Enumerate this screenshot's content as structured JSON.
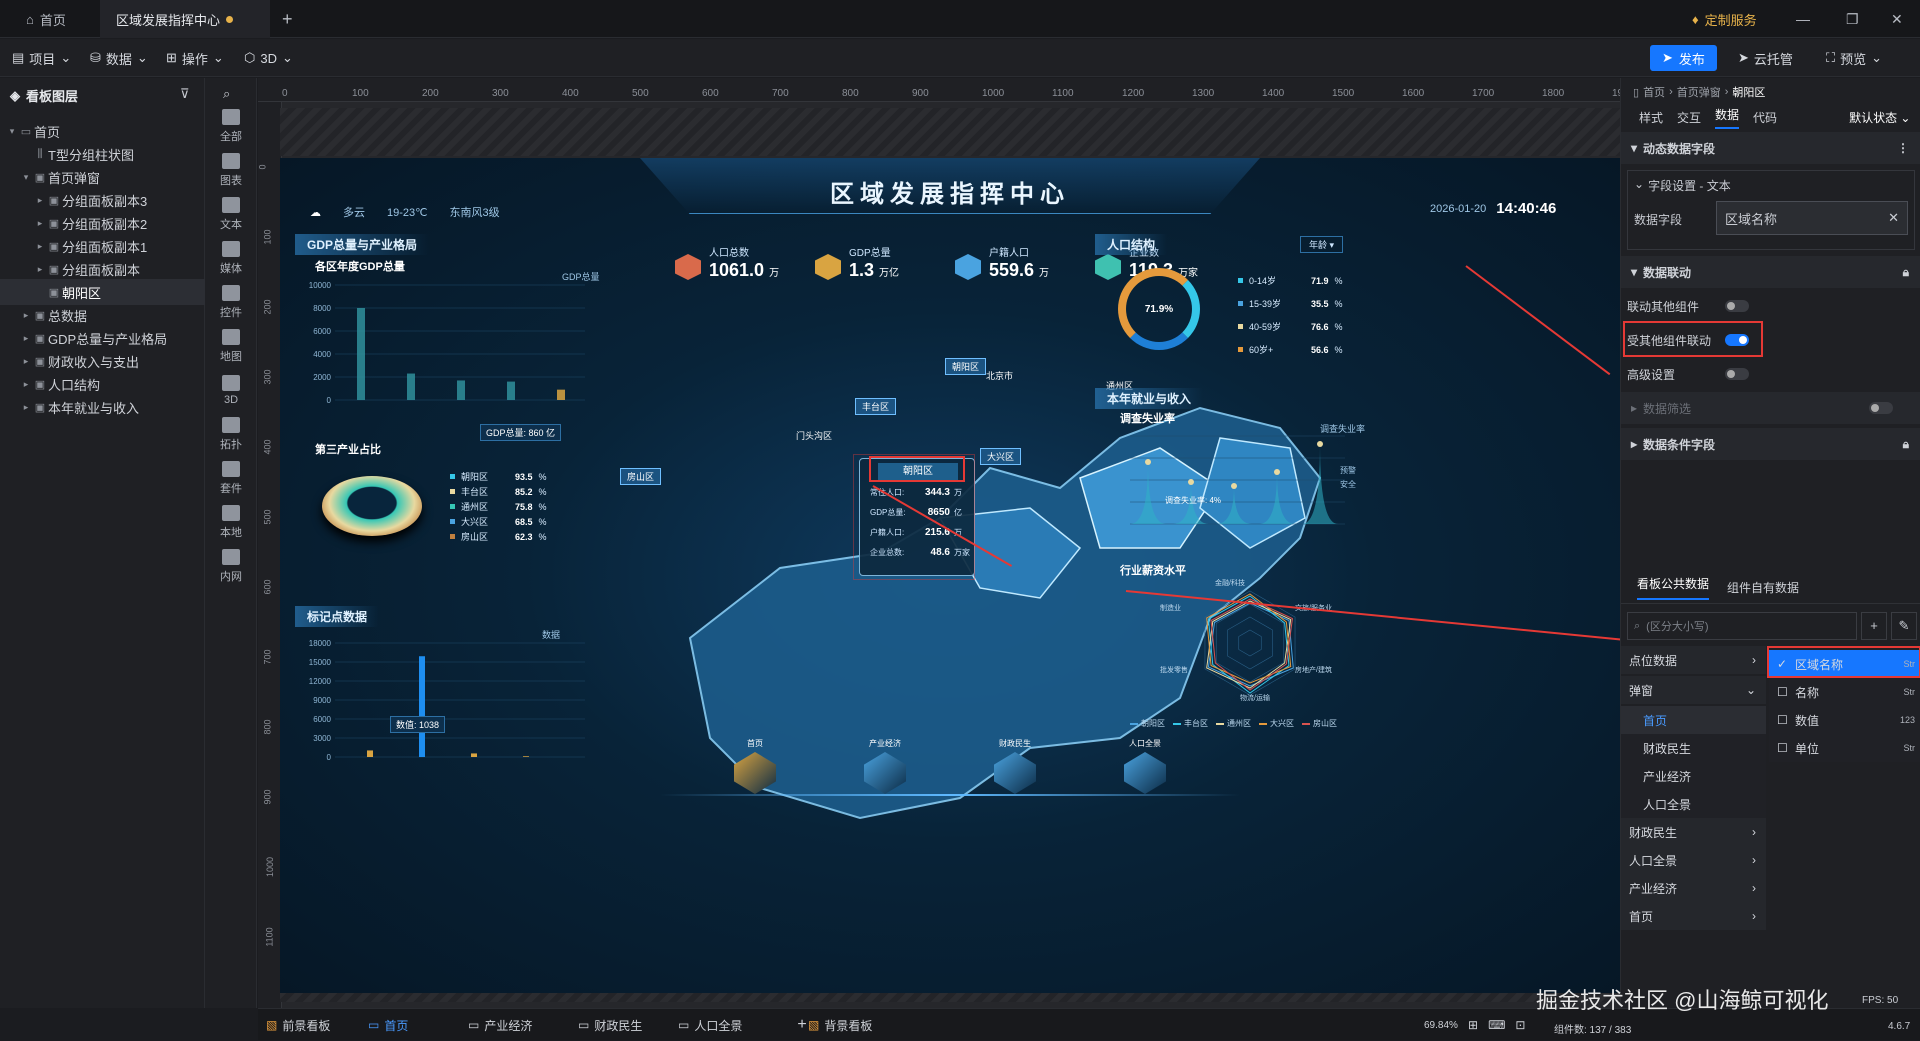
{
  "titlebar": {
    "tabs": [
      {
        "label": "首页"
      },
      {
        "label": "区域发展指挥中心"
      }
    ],
    "custom_service": "定制服务"
  },
  "menubar": {
    "items": [
      "项目",
      "数据",
      "操作",
      "3D"
    ],
    "publish": "发布",
    "cloud_host": "云托管",
    "preview": "预览"
  },
  "left_panel": {
    "title": "看板图层",
    "tree": [
      {
        "label": "首页",
        "depth": 0
      },
      {
        "label": "T型分组柱状图",
        "depth": 1
      },
      {
        "label": "首页弹窗",
        "depth": 1
      },
      {
        "label": "分组面板副本3",
        "depth": 2
      },
      {
        "label": "分组面板副本2",
        "depth": 2
      },
      {
        "label": "分组面板副本1",
        "depth": 2
      },
      {
        "label": "分组面板副本",
        "depth": 2
      },
      {
        "label": "朝阳区",
        "depth": 2
      },
      {
        "label": "总数据",
        "depth": 1
      },
      {
        "label": "GDP总量与产业格局",
        "depth": 1
      },
      {
        "label": "财政收入与支出",
        "depth": 1
      },
      {
        "label": "人口结构",
        "depth": 1
      },
      {
        "label": "本年就业与收入",
        "depth": 1
      }
    ]
  },
  "tools": [
    "全部",
    "图表",
    "文本",
    "媒体",
    "控件",
    "地图",
    "3D",
    "拓扑",
    "套件",
    "本地",
    "内网"
  ],
  "ruler": {
    "h_ticks": [
      "0",
      "100",
      "200",
      "300",
      "400",
      "500",
      "600",
      "700",
      "800",
      "900",
      "1000",
      "1100",
      "1200",
      "1300",
      "1400",
      "1500",
      "1600",
      "1700",
      "1800",
      "1900"
    ],
    "v_ticks": [
      "0",
      "100",
      "200",
      "300",
      "400",
      "500",
      "600",
      "700",
      "800",
      "900",
      "1000",
      "1100"
    ]
  },
  "dashboard": {
    "title": "区域发展指挥中心",
    "weather": "多云",
    "temp": "19-23℃",
    "wind": "东南风3级",
    "date": "2026-01-20",
    "time": "14:40:46",
    "stats": [
      {
        "label": "人口总数",
        "value": "1061.0",
        "unit": "万"
      },
      {
        "label": "GDP总量",
        "value": "1.3",
        "unit": "万亿"
      },
      {
        "label": "户籍人口",
        "value": "559.6",
        "unit": "万"
      },
      {
        "label": "企业数",
        "value": "119.3",
        "unit": "万家"
      }
    ],
    "gdp_panel": {
      "title": "GDP总量与产业格局",
      "sub1": "各区年度GDP总量",
      "legend": "GDP总量",
      "y_ticks": [
        "10000",
        "8000",
        "6000",
        "4000",
        "2000",
        "0"
      ],
      "tooltip": "GDP总量: 860 亿",
      "sub2": "第三产业占比",
      "ratios": [
        {
          "name": "朝阳区",
          "value": "93.5",
          "unit": "%"
        },
        {
          "name": "丰台区",
          "value": "85.2",
          "unit": "%"
        },
        {
          "name": "通州区",
          "value": "75.8",
          "unit": "%"
        },
        {
          "name": "大兴区",
          "value": "68.5",
          "unit": "%"
        },
        {
          "name": "房山区",
          "value": "62.3",
          "unit": "%"
        }
      ]
    },
    "marker_panel": {
      "title": "标记点数据",
      "legend": "数据",
      "y_ticks": [
        "18000",
        "15000",
        "12000",
        "9000",
        "6000",
        "3000",
        "0"
      ],
      "tooltip": "数值: 1038"
    },
    "population_panel": {
      "title": "人口结构",
      "selector": "年龄",
      "center": "71.9%",
      "rows": [
        {
          "name": "0-14岁",
          "value": "71.9",
          "unit": "%"
        },
        {
          "name": "15-39岁",
          "value": "35.5",
          "unit": "%"
        },
        {
          "name": "40-59岁",
          "value": "76.6",
          "unit": "%"
        },
        {
          "name": "60岁+",
          "value": "56.6",
          "unit": "%"
        }
      ]
    },
    "employment_panel": {
      "title": "本年就业与收入",
      "sub1": "调查失业率",
      "legend": "调查失业率",
      "tooltip": "调查失业率: 4%",
      "side_labels": [
        "预警",
        "安全"
      ],
      "sub2": "行业薪资水平",
      "radar_labels": [
        "金融/科技",
        "文旅/服务业",
        "房地产/建筑",
        "物流/运输",
        "批发零售",
        "制造业"
      ],
      "radar_legend": [
        "朝阳区",
        "丰台区",
        "通州区",
        "大兴区",
        "房山区"
      ]
    },
    "map_labels": [
      "房山区",
      "丰台区",
      "朝阳区",
      "大兴区",
      "通州区",
      "门头沟区",
      "北京市"
    ],
    "popup": {
      "title": "朝阳区",
      "rows": [
        {
          "name": "常住人口:",
          "value": "344.3",
          "unit": "万"
        },
        {
          "name": "GDP总量:",
          "value": "8650",
          "unit": "亿"
        },
        {
          "name": "户籍人口:",
          "value": "215.6",
          "unit": "万"
        },
        {
          "name": "企业总数:",
          "value": "48.6",
          "unit": "万家"
        }
      ]
    },
    "nav": [
      "首页",
      "产业经济",
      "财政民生",
      "人口全景"
    ]
  },
  "right_panel": {
    "breadcrumb": [
      "首页",
      "首页弹窗",
      "朝阳区"
    ],
    "tabs": [
      "样式",
      "交互",
      "数据",
      "代码"
    ],
    "state": "默认状态",
    "section1": "动态数据字段",
    "sub1": "字段设置 - 文本",
    "field_label": "数据字段",
    "field_value": "区域名称",
    "section2": "数据联动",
    "link_other": "联动其他组件",
    "linked_by": "受其他组件联动",
    "advanced": "高级设置",
    "filter": "数据筛选",
    "cond_fields": "数据条件字段",
    "data_tabs": [
      "看板公共数据",
      "组件自有数据"
    ],
    "search_placeholder": "(区分大小写)",
    "categories": [
      "点位数据",
      "弹窗",
      "首页",
      "财政民生",
      "产业经济",
      "人口全景",
      "财政民生",
      "人口全景",
      "产业经济",
      "首页"
    ],
    "fields": [
      {
        "name": "区域名称",
        "type": "Str"
      },
      {
        "name": "名称",
        "type": "Str"
      },
      {
        "name": "数值",
        "type": "123"
      },
      {
        "name": "单位",
        "type": "Str"
      }
    ]
  },
  "bottom": {
    "tabs": [
      "前景看板",
      "首页",
      "产业经济",
      "财政民生",
      "人口全景",
      "背景看板"
    ],
    "zoom": "69.84%",
    "watermark": "掘金技术社区 @山海鲸可视化",
    "component_count": "组件数: 137 / 383",
    "fps": "FPS: 50",
    "version": "4.6.7"
  },
  "colors": {
    "accent": "#1677ff",
    "highlight": "#e53935",
    "board_bg": "#082338"
  }
}
